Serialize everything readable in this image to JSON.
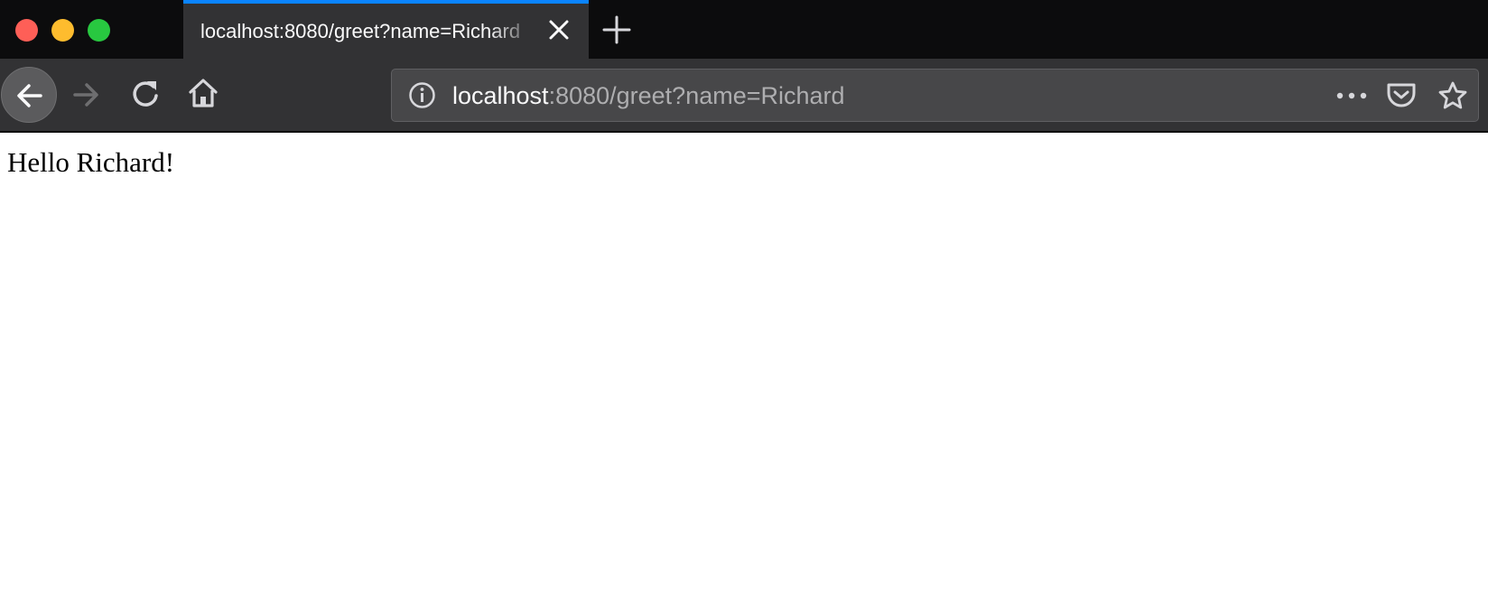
{
  "colors": {
    "tabstrip_bg": "#0c0c0d",
    "toolbar_bg": "#323234",
    "tab_accent": "#0a84ff",
    "urlbar_bg": "#474749",
    "traffic_red": "#fe5f57",
    "traffic_yellow": "#febc2e",
    "traffic_green": "#28c840"
  },
  "tabs": [
    {
      "title": "localhost:8080/greet?name=Richard",
      "active": true
    }
  ],
  "toolbar": {
    "icons": [
      "back-icon",
      "forward-icon",
      "reload-icon",
      "home-icon"
    ]
  },
  "urlbar": {
    "host": "localhost",
    "rest": ":8080/greet?name=Richard",
    "icons": [
      "info-icon",
      "page-actions-icon",
      "pocket-icon",
      "bookmark-star-icon"
    ]
  },
  "page": {
    "text": "Hello Richard!"
  }
}
